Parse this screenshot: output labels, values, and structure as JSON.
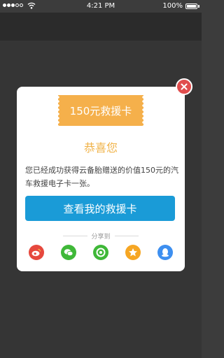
{
  "status_bar": {
    "time": "4:21 PM",
    "battery_percent": "100%",
    "battery_level": 1.0,
    "signal_bars_filled": 3,
    "signal_bars_total": 5
  },
  "modal": {
    "ticket_label": "150元救援卡",
    "title": "恭喜您",
    "message": "您已经成功获得云备胎赠送的价值150元的汽车救援电子卡一张。",
    "primary_button": "查看我的救援卡",
    "share_label": "分享到",
    "share_targets": [
      {
        "icon": "weibo-icon",
        "color": "#e6483d"
      },
      {
        "icon": "wechat-icon",
        "color": "#3fb838"
      },
      {
        "icon": "moments-icon",
        "color": "#3fb838"
      },
      {
        "icon": "qzone-icon",
        "color": "#f6a623"
      },
      {
        "icon": "qq-icon",
        "color": "#3d8ff0"
      }
    ]
  },
  "colors": {
    "accent_orange": "#f5b04b",
    "primary_blue": "#1a9bd7",
    "close_red": "#e04d4d"
  }
}
